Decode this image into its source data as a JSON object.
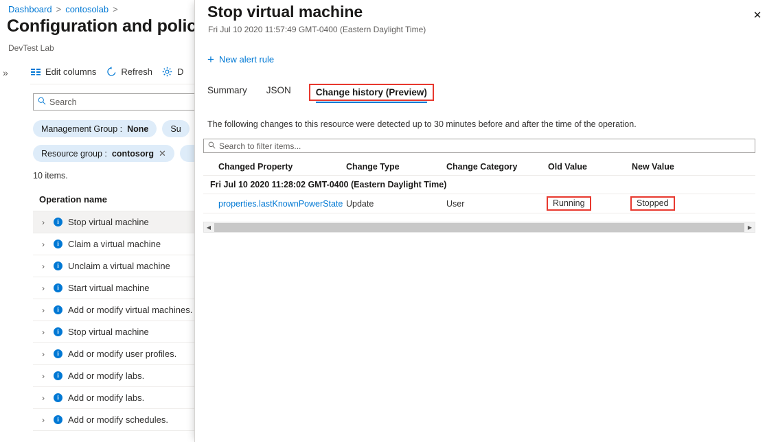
{
  "background": {
    "breadcrumb": {
      "items": [
        "Dashboard",
        "contosolab"
      ],
      "separator": ">"
    },
    "page_title": "Configuration and policies",
    "page_subtitle": "DevTest Lab",
    "expand_chevron": "»",
    "toolbar": [
      {
        "label": "Edit columns",
        "icon": "columns-icon"
      },
      {
        "label": "Refresh",
        "icon": "refresh-icon"
      },
      {
        "label": "D",
        "icon": "gear-icon"
      }
    ],
    "search": {
      "placeholder": "Search",
      "value": "",
      "icon": "search-icon"
    },
    "filters": [
      {
        "label": "Management Group :",
        "value": "None",
        "removable": false
      },
      {
        "label": "Su",
        "value": "",
        "removable": false
      },
      {
        "label": "Resource group :",
        "value": "contosorg",
        "removable": true
      }
    ],
    "items_count": "10 items.",
    "column_header": "Operation name",
    "operations": [
      {
        "label": "Stop virtual machine",
        "selected": true
      },
      {
        "label": "Claim a virtual machine",
        "selected": false
      },
      {
        "label": "Unclaim a virtual machine",
        "selected": false
      },
      {
        "label": "Start virtual machine",
        "selected": false
      },
      {
        "label": "Add or modify virtual machines.",
        "selected": false
      },
      {
        "label": "Stop virtual machine",
        "selected": false
      },
      {
        "label": "Add or modify user profiles.",
        "selected": false
      },
      {
        "label": "Add or modify labs.",
        "selected": false
      },
      {
        "label": "Add or modify labs.",
        "selected": false
      },
      {
        "label": "Add or modify schedules.",
        "selected": false
      }
    ]
  },
  "panel": {
    "title": "Stop virtual machine",
    "subtitle": "Fri Jul 10 2020 11:57:49 GMT-0400 (Eastern Daylight Time)",
    "close_label": "✕",
    "command_new_alert": "New alert rule",
    "tabs": [
      {
        "label": "Summary",
        "active": false,
        "highlighted": false
      },
      {
        "label": "JSON",
        "active": false,
        "highlighted": false
      },
      {
        "label": "Change history (Preview)",
        "active": true,
        "highlighted": true
      }
    ],
    "description": "The following changes to this resource were detected up to 30 minutes before and after the time of the operation.",
    "filter_search": {
      "placeholder": "Search to filter items...",
      "value": "",
      "icon": "search-icon"
    },
    "table": {
      "columns": [
        "Changed Property",
        "Change Type",
        "Change Category",
        "Old Value",
        "New Value"
      ],
      "group_header": "Fri Jul 10 2020 11:28:02 GMT-0400 (Eastern Daylight Time)",
      "rows": [
        {
          "changed_property": "properties.lastKnownPowerState",
          "change_type": "Update",
          "change_category": "User",
          "old_value": "Running",
          "new_value": "Stopped"
        }
      ]
    },
    "scrollbar": {
      "left_arrow": "◀",
      "right_arrow": "▶"
    }
  },
  "colors": {
    "accent_blue": "#0078d4",
    "highlight_red": "#e8382e",
    "pill_bg": "#deecf9",
    "selected_row_bg": "#f3f2f1"
  }
}
